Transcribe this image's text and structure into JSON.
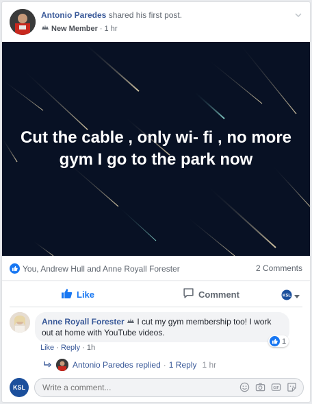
{
  "post": {
    "author": "Antonio Paredes",
    "action": "shared his first post.",
    "badge": "New Member",
    "time": "1 hr",
    "image_text": "Cut the cable , only wi- fi , no more gym I go to the park now"
  },
  "reactions": {
    "summary": "You, Andrew Hull and Anne Royall Forester",
    "comments_count": "2 Comments"
  },
  "actions": {
    "like_label": "Like",
    "comment_label": "Comment",
    "ksl_label": "KSL"
  },
  "comment": {
    "author": "Anne Royall Forester",
    "text": "I cut my gym membership too! I work out at home with YouTube videos.",
    "like_link": "Like",
    "reply_link": "Reply",
    "time": "1h",
    "reaction_count": "1"
  },
  "reply_summary": {
    "author": "Antonio Paredes",
    "action": "replied",
    "count": "1 Reply",
    "time": "1 hr"
  },
  "composer": {
    "placeholder": "Write a comment...",
    "avatar_label": "KSL"
  },
  "colors": {
    "facebook_blue": "#1877f2",
    "link_blue": "#385898",
    "image_background": "#081124"
  }
}
